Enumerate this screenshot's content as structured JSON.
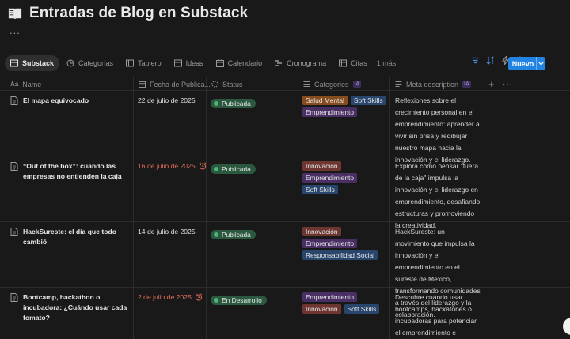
{
  "page": {
    "title": "Entradas de Blog en Substack",
    "more_label": "...",
    "icon": "book-icon"
  },
  "views": [
    {
      "label": "Substack",
      "icon": "table-icon",
      "active": true
    },
    {
      "label": "Categorías",
      "icon": "pie-chart-icon",
      "active": false
    },
    {
      "label": "Tablero",
      "icon": "board-icon",
      "active": false
    },
    {
      "label": "Ideas",
      "icon": "table-icon",
      "active": false
    },
    {
      "label": "Calendario",
      "icon": "calendar-icon",
      "active": false
    },
    {
      "label": "Cronograma",
      "icon": "timeline-icon",
      "active": false
    },
    {
      "label": "Citas",
      "icon": "table-icon",
      "active": false
    }
  ],
  "more_views": "1 más",
  "toolbar": {
    "icons": [
      "filter-icon",
      "sort-icon",
      "lightning-icon",
      "search-icon",
      "settings-icon"
    ],
    "new_button": "Nuevo",
    "new_button_color": "#2383e2"
  },
  "columns": [
    {
      "label": "Name",
      "icon": "text-icon"
    },
    {
      "label": "Fecha de Publica...",
      "icon": "calendar-icon"
    },
    {
      "label": "Status",
      "icon": "status-icon"
    },
    {
      "label": "Categories",
      "icon": "list-icon",
      "badge": "IA"
    },
    {
      "label": "Meta description",
      "icon": "lines-icon",
      "badge": "IA"
    }
  ],
  "status_colors": {
    "Publicada": {
      "bg": "#2b593f",
      "dot": "#4fb37a"
    },
    "En Desarrollo": {
      "bg": "#2b593f",
      "dot": "#4fb37a"
    }
  },
  "tag_colors": {
    "Salud Mental": "#854c1d",
    "Soft Skills": "#28456c",
    "Emprendimiento": "#492f64",
    "Innovación": "#6e3630",
    "Responsabilidad Social": "#28456c"
  },
  "rows": [
    {
      "name": "El mapa equivocado",
      "date": "22 de julio de 2025",
      "overdue": false,
      "status": "Publicada",
      "categories": [
        "Salud Mental",
        "Soft Skills",
        "Emprendimiento"
      ],
      "description": "Reflexiones sobre el crecimiento personal en el emprendimiento: aprender a vivir sin prisa y redibujar nuestro mapa hacia la innovación y el liderazgo."
    },
    {
      "name": "“Out of the box”: cuando las empresas no entienden la caja",
      "date": "16 de julio de 2025",
      "overdue": true,
      "status": "Publicada",
      "categories": [
        "Innovación",
        "Emprendimiento",
        "Soft Skills"
      ],
      "description": "Explora cómo pensar \"fuera de la caja\" impulsa la innovación y el liderazgo en emprendimiento, desafiando estructuras y promoviendo la creatividad."
    },
    {
      "name": "HackSureste: el día que todo cambió",
      "date": "14 de julio de 2025",
      "overdue": false,
      "status": "Publicada",
      "categories": [
        "Innovación",
        "Emprendimiento",
        "Responsabilidad Social"
      ],
      "description": "HackSureste: un movimiento que impulsa la innovación y el emprendimiento en el sureste de México, transformando comunidades a través del liderazgo y la colaboración."
    },
    {
      "name": "Bootcamp, hackathon o incubadora: ¿Cuándo usar cada fomato?",
      "date": "2 de julio de 2025",
      "overdue": true,
      "status": "En Desarrollo",
      "categories": [
        "Emprendimiento",
        "Innovación",
        "Soft Skills"
      ],
      "description": "Descubre cuándo usar bootcamps, hackatones o incubadoras para potenciar el emprendimiento e innovación. Aprende a"
    }
  ]
}
